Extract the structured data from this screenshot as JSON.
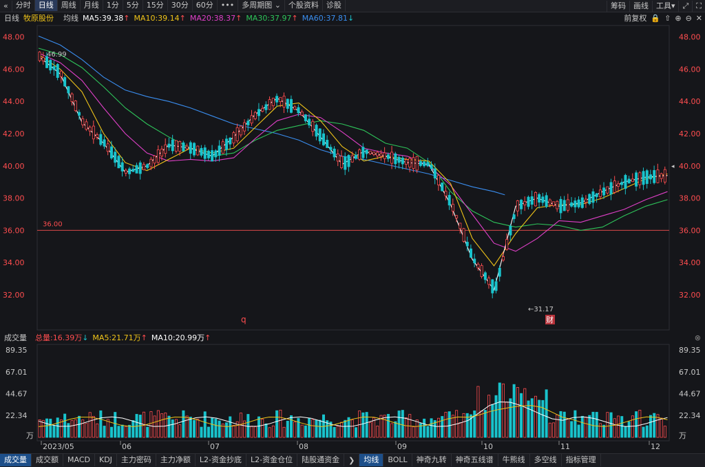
{
  "toolbar": {
    "items": [
      "分时",
      "日线",
      "周线",
      "月线",
      "1分",
      "5分",
      "15分",
      "30分",
      "60分",
      "•••",
      "多周期图 ⌄",
      "个股资料",
      "诊股"
    ],
    "active_index": 1,
    "right_items": [
      "筹码",
      "画线",
      "工具▾"
    ]
  },
  "info": {
    "period": "日线",
    "stock": "牧原股份",
    "ma_label": "均线",
    "ma5": "MA5:39.38",
    "ma10": "MA10:39.14",
    "ma20": "MA20:38.37",
    "ma30": "MA30:37.97",
    "ma60": "MA60:37.81",
    "adjust": "前复权"
  },
  "volume_info": {
    "title": "成交量",
    "total": "总量:16.39万",
    "ma5": "MA5:21.71万",
    "ma10": "MA10:20.99万"
  },
  "bottom_tabs_left": [
    "成交量",
    "成交额",
    "MACD",
    "KDJ",
    "主力密码",
    "主力净额",
    "L2-资金抄底",
    "L2-资金仓位",
    "陆股通资金"
  ],
  "bottom_tabs_right": [
    "均线",
    "BOLL",
    "神奇九转",
    "神奇五线谱",
    "牛熊线",
    "多空线",
    "指标管理"
  ],
  "colors": {
    "up": "#ff4d4f",
    "down": "#19c3cc",
    "ma5": "#ffffff",
    "ma10": "#f0c419",
    "ma20": "#e040c8",
    "ma30": "#2ec45a",
    "ma60": "#3a8ef0",
    "axis_text": "#ff4d4f",
    "background": "#15161a"
  },
  "chart_data": {
    "type": "candlestick",
    "y_ticks": [
      "48.00",
      "46.00",
      "44.00",
      "42.00",
      "40.00",
      "38.00",
      "36.00",
      "34.00",
      "32.00"
    ],
    "ylim": [
      31,
      48.5
    ],
    "x_labels": [
      "2023/05",
      "06",
      "07",
      "08",
      "09",
      "10",
      "11",
      "12"
    ],
    "annotations": {
      "high": "46.99",
      "low": "←31.17",
      "price_line": "36.00",
      "marker_q": "q",
      "marker_cai": "财"
    },
    "volume": {
      "y_ticks": [
        "89.35",
        "67.01",
        "44.67",
        "22.34"
      ],
      "unit": "万",
      "ylim": [
        0,
        89.35
      ]
    },
    "ma_paths": {
      "ma60": [
        [
          0,
          48.05
        ],
        [
          20,
          47.5
        ],
        [
          40,
          46.6
        ],
        [
          60,
          45.5
        ],
        [
          80,
          44.7
        ],
        [
          100,
          44.3
        ],
        [
          120,
          44.0
        ],
        [
          140,
          43.6
        ],
        [
          160,
          43.1
        ],
        [
          180,
          42.6
        ],
        [
          200,
          42.3
        ],
        [
          220,
          42.0
        ],
        [
          240,
          41.6
        ],
        [
          260,
          41.0
        ],
        [
          280,
          40.6
        ],
        [
          300,
          40.4
        ],
        [
          320,
          40.1
        ],
        [
          340,
          39.8
        ],
        [
          360,
          39.5
        ],
        [
          380,
          39.1
        ],
        [
          400,
          38.7
        ],
        [
          420,
          38.4
        ],
        [
          430,
          38.2
        ]
      ],
      "ma30": [
        [
          0,
          47.3
        ],
        [
          20,
          46.9
        ],
        [
          40,
          46.1
        ],
        [
          60,
          44.9
        ],
        [
          80,
          43.6
        ],
        [
          100,
          42.6
        ],
        [
          120,
          41.8
        ],
        [
          140,
          41.1
        ],
        [
          160,
          40.6
        ],
        [
          180,
          40.8
        ],
        [
          200,
          41.6
        ],
        [
          220,
          42.2
        ],
        [
          240,
          42.5
        ],
        [
          260,
          42.8
        ],
        [
          280,
          42.6
        ],
        [
          300,
          42.2
        ],
        [
          320,
          41.4
        ],
        [
          340,
          41.1
        ],
        [
          360,
          40.2
        ],
        [
          380,
          38.4
        ],
        [
          400,
          37.2
        ],
        [
          420,
          36.5
        ],
        [
          440,
          36.2
        ],
        [
          460,
          36.4
        ],
        [
          480,
          36.3
        ],
        [
          500,
          36.0
        ],
        [
          520,
          36.2
        ],
        [
          540,
          36.9
        ],
        [
          560,
          37.5
        ],
        [
          580,
          37.9
        ]
      ],
      "ma20": [
        [
          0,
          47.0
        ],
        [
          20,
          46.4
        ],
        [
          40,
          45.3
        ],
        [
          60,
          43.6
        ],
        [
          80,
          42.0
        ],
        [
          100,
          40.8
        ],
        [
          120,
          40.3
        ],
        [
          140,
          40.4
        ],
        [
          160,
          40.3
        ],
        [
          180,
          40.5
        ],
        [
          200,
          41.7
        ],
        [
          220,
          42.8
        ],
        [
          240,
          43.2
        ],
        [
          260,
          43.0
        ],
        [
          280,
          42.1
        ],
        [
          300,
          41.1
        ],
        [
          320,
          40.8
        ],
        [
          340,
          40.6
        ],
        [
          360,
          40.0
        ],
        [
          380,
          38.8
        ],
        [
          400,
          37.0
        ],
        [
          420,
          35.2
        ],
        [
          440,
          34.7
        ],
        [
          460,
          35.5
        ],
        [
          480,
          36.6
        ],
        [
          500,
          36.5
        ],
        [
          520,
          36.9
        ],
        [
          540,
          37.3
        ],
        [
          560,
          37.9
        ],
        [
          580,
          38.4
        ]
      ],
      "ma10": [
        [
          0,
          46.9
        ],
        [
          20,
          46.0
        ],
        [
          40,
          44.6
        ],
        [
          60,
          42.0
        ],
        [
          80,
          40.2
        ],
        [
          100,
          39.7
        ],
        [
          120,
          40.4
        ],
        [
          140,
          41.1
        ],
        [
          160,
          40.8
        ],
        [
          180,
          41.1
        ],
        [
          200,
          42.4
        ],
        [
          220,
          43.7
        ],
        [
          240,
          43.9
        ],
        [
          260,
          42.8
        ],
        [
          280,
          41.2
        ],
        [
          300,
          40.3
        ],
        [
          320,
          40.6
        ],
        [
          340,
          40.4
        ],
        [
          360,
          40.3
        ],
        [
          380,
          38.9
        ],
        [
          400,
          35.5
        ],
        [
          420,
          33.8
        ],
        [
          440,
          35.8
        ],
        [
          460,
          37.4
        ],
        [
          480,
          37.6
        ],
        [
          500,
          37.6
        ],
        [
          520,
          38.0
        ],
        [
          540,
          38.6
        ],
        [
          560,
          39.2
        ],
        [
          580,
          39.5
        ]
      ],
      "ma5": [
        [
          0,
          46.8
        ],
        [
          20,
          45.7
        ],
        [
          40,
          42.7
        ],
        [
          60,
          41.4
        ],
        [
          80,
          39.6
        ],
        [
          100,
          40.0
        ],
        [
          120,
          41.3
        ],
        [
          140,
          41.1
        ],
        [
          160,
          40.6
        ],
        [
          180,
          41.8
        ],
        [
          200,
          43.2
        ],
        [
          220,
          44.2
        ],
        [
          240,
          43.4
        ],
        [
          260,
          41.8
        ],
        [
          280,
          40.1
        ],
        [
          300,
          40.9
        ],
        [
          320,
          40.6
        ],
        [
          340,
          40.2
        ],
        [
          360,
          40.1
        ],
        [
          380,
          37.6
        ],
        [
          400,
          34.2
        ],
        [
          420,
          32.3
        ],
        [
          440,
          37.5
        ],
        [
          460,
          38.0
        ],
        [
          480,
          37.5
        ],
        [
          500,
          37.7
        ],
        [
          520,
          38.4
        ],
        [
          540,
          39.0
        ],
        [
          560,
          39.3
        ],
        [
          580,
          39.4
        ]
      ]
    }
  }
}
